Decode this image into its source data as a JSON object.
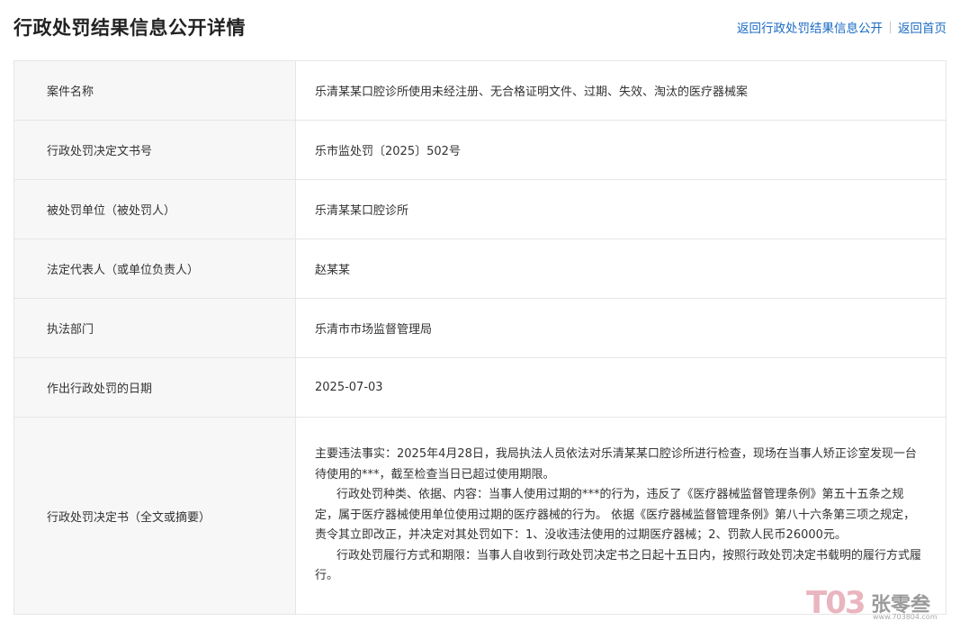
{
  "header": {
    "title": "行政处罚结果信息公开详情",
    "links": [
      "返回行政处罚结果信息公开",
      "返回首页"
    ]
  },
  "rows": [
    {
      "label": "案件名称",
      "value": "乐清某某口腔诊所使用未经注册、无合格证明文件、过期、失效、淘汰的医疗器械案"
    },
    {
      "label": "行政处罚决定文书号",
      "value": "乐市监处罚〔2025〕502号"
    },
    {
      "label": "被处罚单位（被处罚人）",
      "value": "乐清某某口腔诊所"
    },
    {
      "label": "法定代表人（或单位负责人）",
      "value": "赵某某"
    },
    {
      "label": "执法部门",
      "value": "乐清市市场监督管理局"
    },
    {
      "label": "作出行政处罚的日期",
      "value": "2025-07-03"
    }
  ],
  "decision": {
    "label": "行政处罚决定书（全文或摘要）",
    "paragraphs": [
      "主要违法事实：2025年4月28日，我局执法人员依法对乐清某某口腔诊所进行检查，现场在当事人矫正诊室发现一台待使用的***，截至检查当日已超过使用期限。",
      "行政处罚种类、依据、内容：当事人使用过期的***的行为，违反了《医疗器械监督管理条例》第五十五条之规定，属于医疗器械使用单位使用过期的医疗器械的行为。   依据《医疗器械监督管理条例》第八十六条第三项之规定，责令其立即改正，并决定对其处罚如下：1、没收违法使用的过期医疗器械；2、罚款人民币26000元。",
      "行政处罚履行方式和期限：当事人自收到行政处罚决定书之日起十五日内，按照行政处罚决定书载明的履行方式履行。"
    ]
  },
  "watermark": {
    "logo": "T03",
    "name": "张零叁",
    "url": "www.703804.com"
  }
}
